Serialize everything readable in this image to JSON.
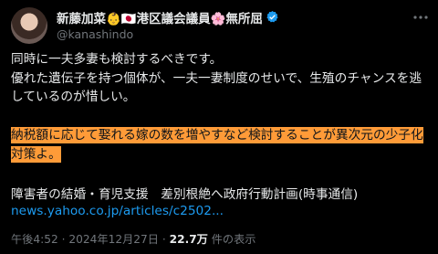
{
  "author": {
    "display_name": "新藤加菜👶🇯🇵港区議会議員🌸無所屈",
    "handle": "@kanashindo"
  },
  "post": {
    "lines": [
      "同時に一夫多妻も検討するべきです。",
      "優れた遺伝子を持つ個体が、一夫一妻制度のせいで、生殖のチャンスを逃",
      "しているのが惜しい。"
    ],
    "highlight_lines": [
      "納税額に応じて娶れる嫁の数を増やすなど検討することが異次元の少子化",
      "対策よ。"
    ],
    "news_title": "障害者の結婚・育児支援　差別根絶へ政府行動計画(時事通信)",
    "link_text": "news.yahoo.co.jp/articles/c2502..."
  },
  "meta": {
    "time": "午後4:52",
    "separator": "·",
    "date": "2024年12月27日",
    "views_count": "22.7万",
    "views_label": "件の表示"
  },
  "colors": {
    "background": "#000000",
    "text": "#e7e9ea",
    "secondary": "#71767b",
    "link": "#1d9bf0",
    "highlight": "#ff9b38",
    "verified": "#1d9bf0"
  },
  "icons": {
    "verified": "verified-badge-icon",
    "more": "more-options-icon"
  }
}
